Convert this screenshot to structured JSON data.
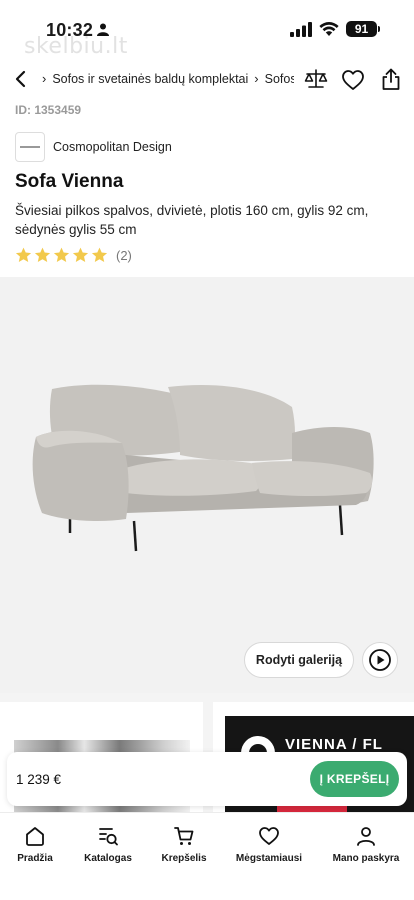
{
  "status_bar": {
    "time": "10:32",
    "battery": "91",
    "watermark": "skelbiu.lt"
  },
  "nav": {
    "breadcrumbs": [
      "Sofos ir svetainės baldų komplektai",
      "Sofos"
    ]
  },
  "product": {
    "id_label": "ID: 1353459",
    "brand": "Cosmopolitan Design",
    "title": "Sofa Vienna",
    "description": "Šviesiai pilkos spalvos, dvivietė, plotis 160 cm, gylis 92 cm, sėdynės gylis 55 cm",
    "rating": 5,
    "rating_count": "(2)",
    "star_color": "#f2c94c"
  },
  "gallery": {
    "button_label": "Rodyti galeriją"
  },
  "related": {
    "banner_text": "VIENNA / FL"
  },
  "purchase": {
    "price": "1 239 €",
    "cart_label": "Į KREPŠELĮ",
    "accent_color": "#3bab70"
  },
  "tabs": [
    {
      "label": "Pradžia",
      "icon": "home-icon"
    },
    {
      "label": "Katalogas",
      "icon": "catalog-search-icon"
    },
    {
      "label": "Krepšelis",
      "icon": "cart-icon"
    },
    {
      "label": "Mėgstamiausi",
      "icon": "heart-icon"
    },
    {
      "label": "Mano paskyra",
      "icon": "user-icon"
    }
  ]
}
